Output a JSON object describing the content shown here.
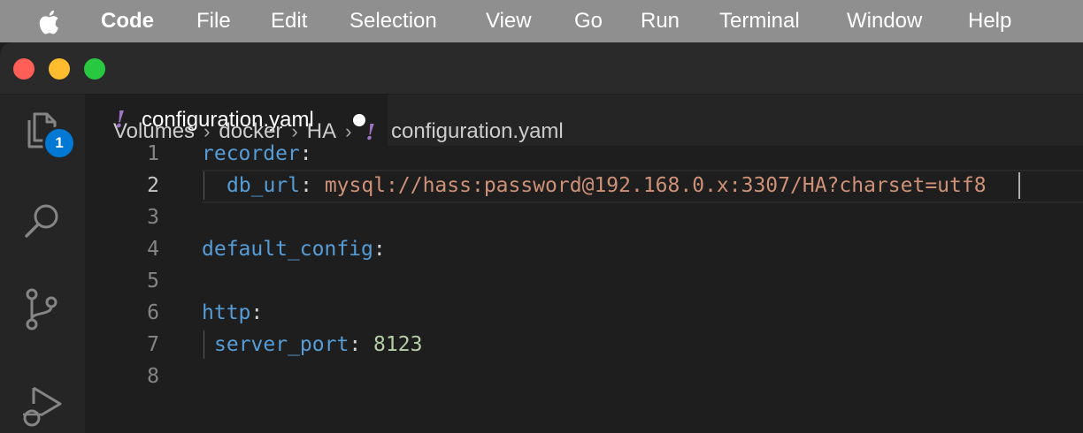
{
  "menubar": {
    "app_name": "Code",
    "items": [
      "File",
      "Edit",
      "Selection",
      "View",
      "Go",
      "Run",
      "Terminal",
      "Window",
      "Help"
    ]
  },
  "activity_bar": {
    "icons": [
      "explorer-icon",
      "search-icon",
      "source-control-icon",
      "run-debug-icon"
    ],
    "explorer_badge": "1"
  },
  "tab": {
    "icon_glyph": "!",
    "label": "configuration.yaml"
  },
  "breadcrumb": {
    "parts": [
      "Volumes",
      "docker",
      "HA"
    ],
    "separator": "›",
    "icon_glyph": "!",
    "file": "configuration.yaml"
  },
  "editor": {
    "active_line": 2,
    "lines": [
      {
        "number": "1",
        "key": "recorder",
        "colon": ":",
        "value": ""
      },
      {
        "number": "2",
        "key": "db_url",
        "colon": ":",
        "value": "mysql://hass:password@192.168.0.x:3307/HA?charset=utf8"
      },
      {
        "number": "3",
        "key": "",
        "colon": "",
        "value": ""
      },
      {
        "number": "4",
        "key": "default_config",
        "colon": ":",
        "value": ""
      },
      {
        "number": "5",
        "key": "",
        "colon": "",
        "value": ""
      },
      {
        "number": "6",
        "key": "http",
        "colon": ":",
        "value": ""
      },
      {
        "number": "7",
        "key": "server_port",
        "colon": ":",
        "value": "8123"
      },
      {
        "number": "8",
        "key": "",
        "colon": "",
        "value": ""
      }
    ]
  },
  "colors": {
    "yaml_key": "#569cd6",
    "yaml_string": "#ce9178",
    "yaml_number": "#b5cea8",
    "yaml_icon": "#a074c4",
    "badge": "#0078d4",
    "traffic_close": "#ff5f57",
    "traffic_minimize": "#febc2e",
    "traffic_zoom": "#28c840"
  }
}
